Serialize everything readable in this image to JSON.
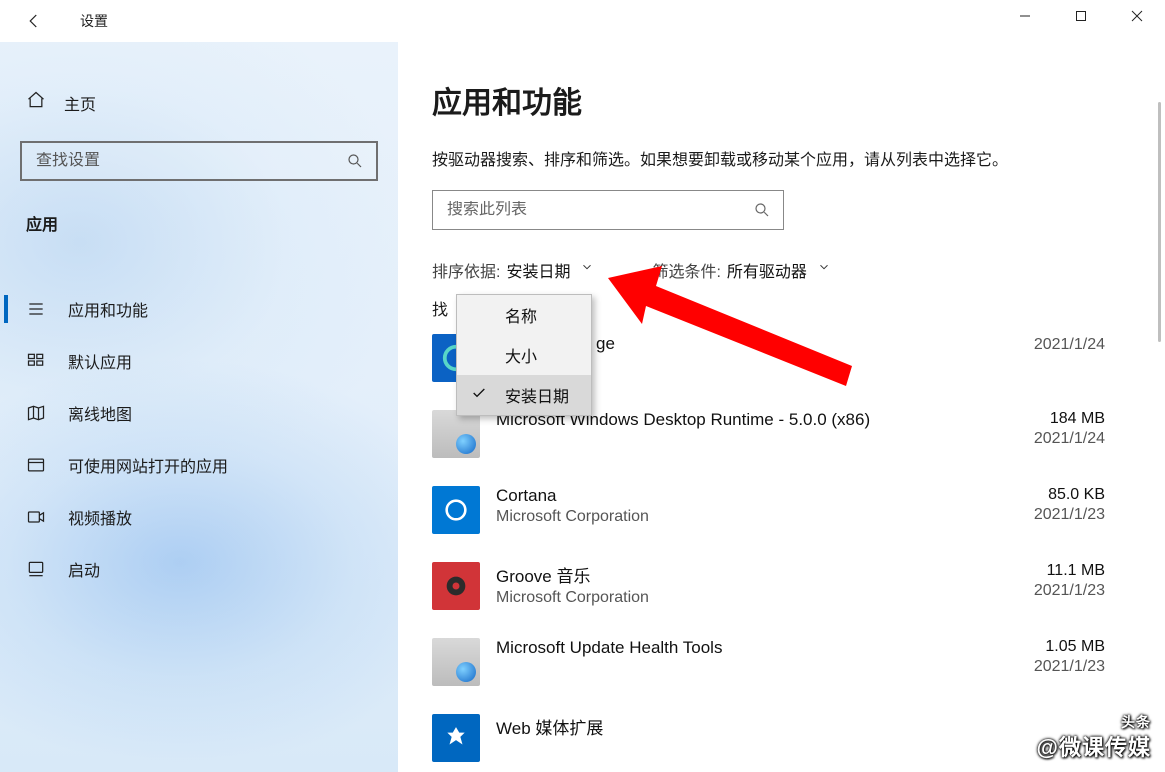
{
  "window": {
    "title": "设置",
    "minimize": "–",
    "maximize": "☐",
    "close": "✕"
  },
  "sidebar": {
    "home_label": "主页",
    "search_placeholder": "查找设置",
    "section_label": "应用",
    "items": [
      {
        "label": "应用和功能",
        "icon": "list",
        "active": true
      },
      {
        "label": "默认应用",
        "icon": "defaults",
        "active": false
      },
      {
        "label": "离线地图",
        "icon": "map",
        "active": false
      },
      {
        "label": "可使用网站打开的应用",
        "icon": "link",
        "active": false
      },
      {
        "label": "视频播放",
        "icon": "video",
        "active": false
      },
      {
        "label": "启动",
        "icon": "startup",
        "active": false
      }
    ]
  },
  "content": {
    "page_title": "应用和功能",
    "description": "按驱动器搜索、排序和筛选。如果想要卸载或移动某个应用，请从列表中选择它。",
    "list_search_placeholder": "搜索此列表",
    "sort_label": "排序依据:",
    "sort_value": "安装日期",
    "filter_label": "筛选条件:",
    "filter_value": "所有驱动器",
    "found_prefix": "找",
    "sort_menu": {
      "items": [
        {
          "label": "名称",
          "selected": false
        },
        {
          "label": "大小",
          "selected": false
        },
        {
          "label": "安装日期",
          "selected": true
        }
      ]
    },
    "apps": [
      {
        "name_partial": "ge",
        "publisher": "",
        "size": "",
        "date": "2021/1/24",
        "icon": "edge"
      },
      {
        "name": "Microsoft Windows Desktop Runtime - 5.0.0 (x86)",
        "publisher": "",
        "size": "184 MB",
        "date": "2021/1/24",
        "icon": "install"
      },
      {
        "name": "Cortana",
        "publisher": "Microsoft Corporation",
        "size": "85.0 KB",
        "date": "2021/1/23",
        "icon": "cortana"
      },
      {
        "name": "Groove 音乐",
        "publisher": "Microsoft Corporation",
        "size": "11.1 MB",
        "date": "2021/1/23",
        "icon": "groove"
      },
      {
        "name": "Microsoft Update Health Tools",
        "publisher": "",
        "size": "1.05 MB",
        "date": "2021/1/23",
        "icon": "install"
      },
      {
        "name": "Web 媒体扩展",
        "publisher": "",
        "size": "",
        "date": "",
        "icon": "web"
      }
    ]
  },
  "watermark": {
    "small": "头条",
    "main": "@微课传媒"
  }
}
